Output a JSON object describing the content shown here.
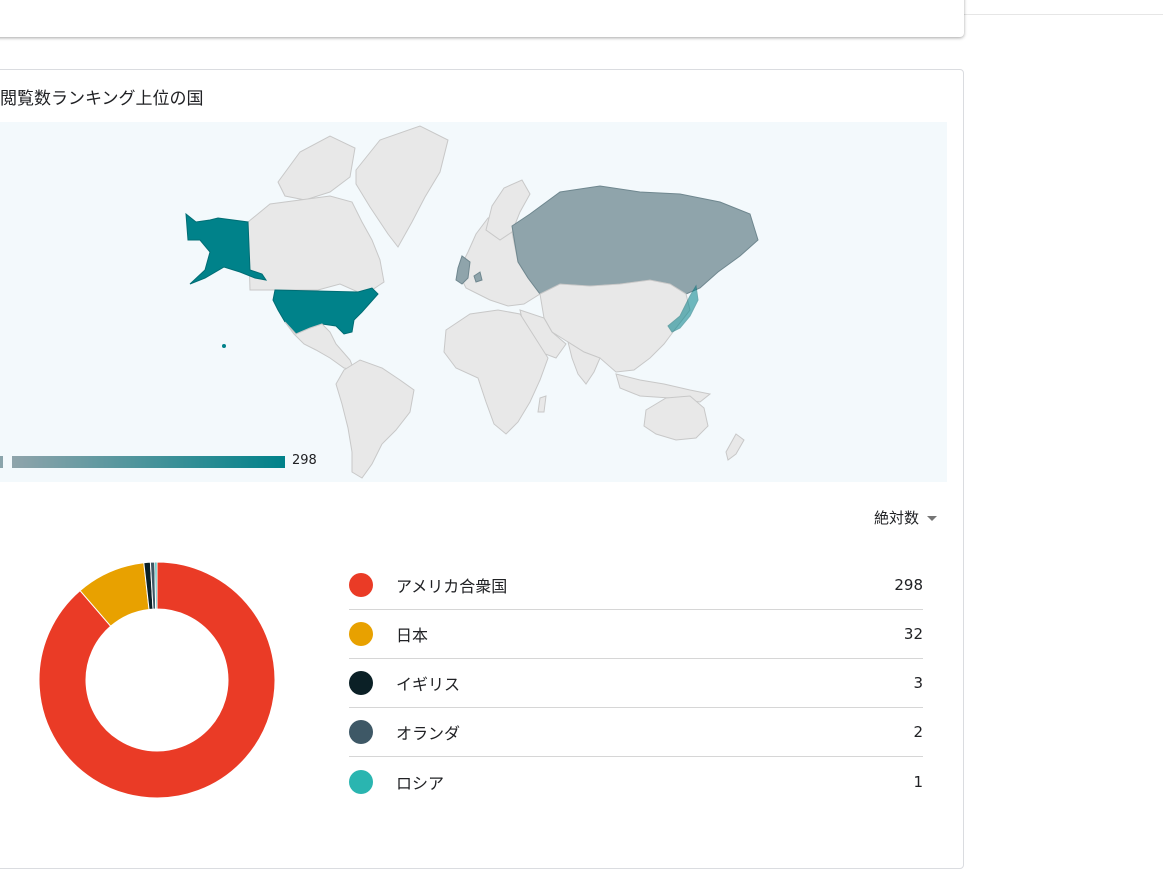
{
  "card": {
    "title": "閲覧数ランキング上位の国",
    "metric_select": "絶対数",
    "scale_max": "298"
  },
  "map": {
    "highlight_color": "#00828a",
    "secondary_color": "#8fa4ab",
    "other_color": "#e8e8e8",
    "ocean_color": "#f3f9fc",
    "regions": [
      {
        "name": "アメリカ合衆国",
        "value": 298
      },
      {
        "name": "日本",
        "value": 32
      },
      {
        "name": "イギリス",
        "value": 3
      },
      {
        "name": "オランダ",
        "value": 2
      },
      {
        "name": "ロシア",
        "value": 1
      }
    ]
  },
  "chart_data": {
    "type": "pie",
    "categories": [
      "アメリカ合衆国",
      "日本",
      "イギリス",
      "オランダ",
      "ロシア"
    ],
    "values": [
      298,
      32,
      3,
      2,
      1
    ],
    "colors": [
      "#ea3b26",
      "#e8a100",
      "#0b2026",
      "#3e5866",
      "#2ab5b0"
    ]
  },
  "legend": [
    {
      "label": "アメリカ合衆国",
      "value": "298",
      "color": "#ea3b26"
    },
    {
      "label": "日本",
      "value": "32",
      "color": "#e8a100"
    },
    {
      "label": "イギリス",
      "value": "3",
      "color": "#0b2026"
    },
    {
      "label": "オランダ",
      "value": "2",
      "color": "#3e5866"
    },
    {
      "label": "ロシア",
      "value": "1",
      "color": "#2ab5b0"
    }
  ]
}
